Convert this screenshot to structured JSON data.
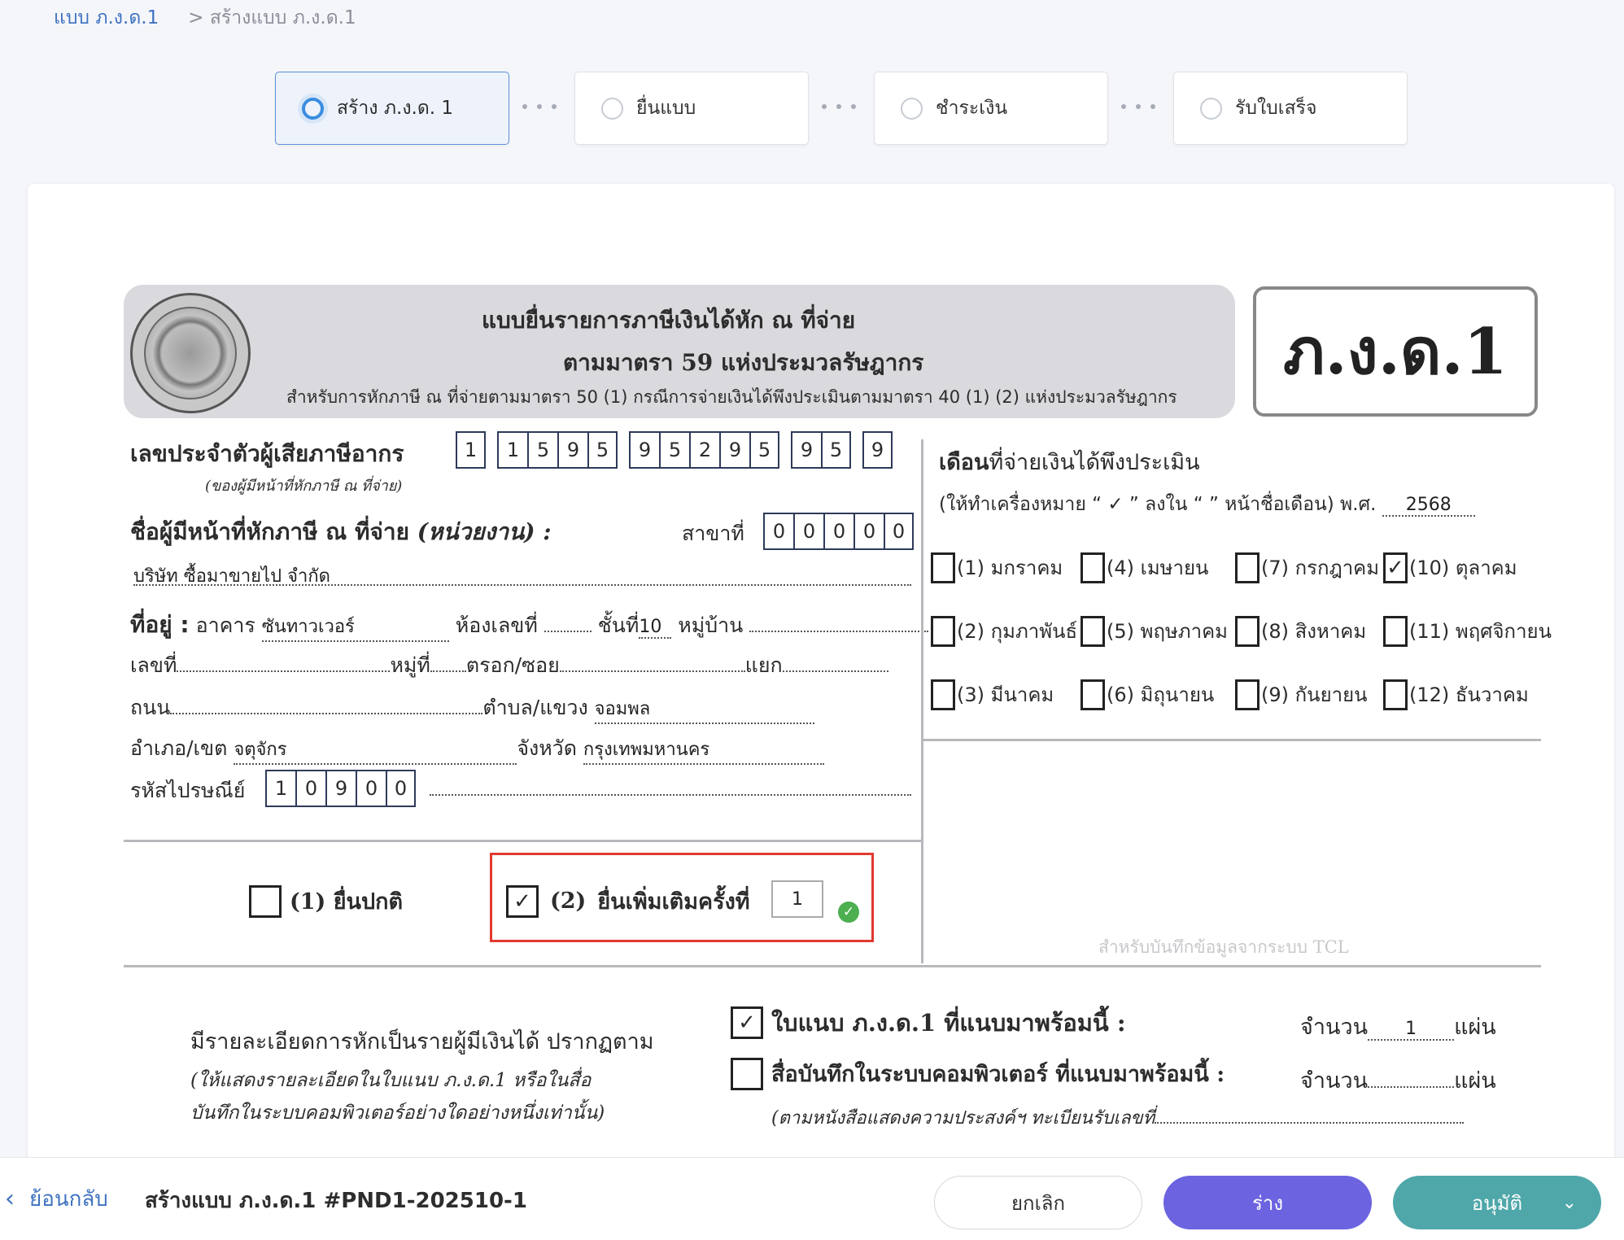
{
  "breadcrumb": {
    "parent": "แบบ ภ.ง.ด.1",
    "current": "> สร้างแบบ ภ.ง.ด.1"
  },
  "steps": [
    {
      "label": "สร้าง ภ.ง.ด. 1",
      "active": true
    },
    {
      "label": "ยื่นแบบ",
      "active": false
    },
    {
      "label": "ชำระเงิน",
      "active": false
    },
    {
      "label": "รับใบเสร็จ",
      "active": false
    }
  ],
  "form": {
    "title1": "แบบยื่นรายการภาษีเงินได้หัก ณ ที่จ่าย",
    "title2": "ตามมาตรา 59 แห่งประมวลรัษฎากร",
    "title3": "สำหรับการหักภาษี ณ ที่จ่ายตามมาตรา 50 (1) กรณีการจ่ายเงินได้พึงประเมินตามมาตรา 40 (1) (2) แห่งประมวลรัษฎากร",
    "form_code": "ภ.ง.ด.1",
    "tax_id_label": "เลขประจำตัวผู้เสียภาษีอากร",
    "tax_id_sub": "(ของผู้มีหน้าที่หักภาษี ณ ที่จ่าย)",
    "tax_id_groups": [
      [
        "1"
      ],
      [
        "1",
        "5",
        "9",
        "5"
      ],
      [
        "9",
        "5",
        "2",
        "9",
        "5"
      ],
      [
        "9",
        "5"
      ],
      [
        "9"
      ]
    ],
    "payer_label": "ชื่อผู้มีหน้าที่หักภาษี ณ ที่จ่าย",
    "payer_label_italic": "(หน่วยงาน) :",
    "branch_label": "สาขาที่",
    "branch_digits": [
      "0",
      "0",
      "0",
      "0",
      "0"
    ],
    "company_name": "บริษัท ซื้อมาขายไป จำกัด",
    "address_label": "ที่อยู่ :",
    "building_label": "อาคาร",
    "building_value": "ซันทาวเวอร์",
    "room_label": "ห้องเลขที่",
    "floor_label": "ชั้นที่",
    "floor_value": "10",
    "village_label": "หมู่บ้าน",
    "number_label": "เลขที่",
    "moo_label": "หมู่ที่",
    "soi_label": "ตรอก/ซอย",
    "yaek_label": "แยก",
    "road_label": "ถนน",
    "subdistrict_label": "ตำบล/แขวง",
    "subdistrict_value": "จอมพล",
    "district_label": "อำเภอ/เขต",
    "district_value": "จตุจักร",
    "province_label": "จังหวัด",
    "province_value": "กรุงเทพมหานคร",
    "postal_label": "รหัสไปรษณีย์",
    "postal_digits": [
      "1",
      "0",
      "9",
      "0",
      "0"
    ],
    "month_title_bold": "เดือน",
    "month_title_rest": "ที่จ่ายเงินได้พึงประเมิน",
    "month_instruction": "(ให้ทำเครื่องหมาย “ ✓ ” ลงใน “ ” หน้าชื่อเดือน) พ.ศ.",
    "year_value": "2568",
    "months": [
      {
        "label": "(1) มกราคม",
        "checked": false
      },
      {
        "label": "(4) เมษายน",
        "checked": false
      },
      {
        "label": "(7) กรกฎาคม",
        "checked": false
      },
      {
        "label": "(10) ตุลาคม",
        "checked": true
      },
      {
        "label": "(2) กุมภาพันธ์",
        "checked": false
      },
      {
        "label": "(5) พฤษภาคม",
        "checked": false
      },
      {
        "label": "(8) สิงหาคม",
        "checked": false
      },
      {
        "label": "(11) พฤศจิกายน",
        "checked": false
      },
      {
        "label": "(3) มีนาคม",
        "checked": false
      },
      {
        "label": "(6) มิถุนายน",
        "checked": false
      },
      {
        "label": "(9) กันยายน",
        "checked": false
      },
      {
        "label": "(12) ธันวาคม",
        "checked": false
      }
    ],
    "normal_filing": "(1) ยื่นปกติ",
    "additional_num": "(2)",
    "additional_label": "ยื่นเพิ่มเติมครั้งที่",
    "additional_value": "1",
    "tcl_note": "สำหรับบันทึกข้อมูลจากระบบ TCL",
    "detail_text": "มีรายละเอียดการหักเป็นรายผู้มีเงินได้ ปรากฏตาม",
    "detail_note1": "(ให้แสดงรายละเอียดในใบแนบ ภ.ง.ด.1 หรือในสื่อ",
    "detail_note2": "บันทึกในระบบคอมพิวเตอร์อย่างใดอย่างหนึ่งเท่านั้น)",
    "attach_label": "ใบแนบ ภ.ง.ด.1 ที่แนบมาพร้อมนี้ :",
    "attach_count_label": "จำนวน",
    "attach_count": "1",
    "attach_unit": "แผ่น",
    "media_label": "สื่อบันทึกในระบบคอมพิวเตอร์ ที่แนบมาพร้อมนี้ :",
    "media_count_label": "จำนวน",
    "media_unit": "แผ่น",
    "media_note": "(ตามหนังสือแสดงความประสงค์ฯ ทะเบียนรับเลขที่"
  },
  "footer": {
    "back": "ย้อนกลับ",
    "doc_title": "สร้างแบบ ภ.ง.ด.1 #PND1-202510-1",
    "cancel": "ยกเลิก",
    "draft": "ร่าง",
    "approve": "อนุมัติ"
  },
  "colors": {
    "accent_blue": "#3a8de0",
    "draft_btn": "#6b63e0",
    "approve_btn": "#4fa7a9",
    "highlight_red": "#e03a2f"
  }
}
